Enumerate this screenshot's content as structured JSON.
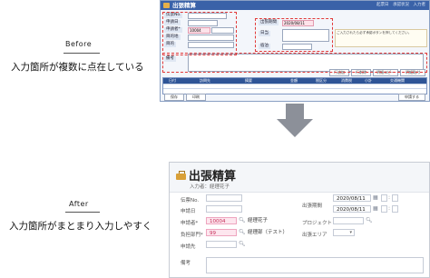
{
  "labels": {
    "before": "Before",
    "before_desc": "入力箇所が複数に点在している",
    "after": "After",
    "after_desc": "入力箇所がまとまり入力しやすく"
  },
  "before_screen": {
    "title": "出張精算",
    "header_right": "起票日　承認状況　入力者",
    "fields": [
      {
        "label": "伝票No.",
        "value": ""
      },
      {
        "label": "申請日",
        "value": ""
      },
      {
        "label": "申請者*",
        "value": "10004"
      },
      {
        "label": "目的地",
        "value": ""
      },
      {
        "label": "目的",
        "value": ""
      },
      {
        "label": "備考",
        "value": ""
      }
    ],
    "right_fields": [
      {
        "label": "出張期間",
        "value": "2020/08/11"
      },
      {
        "label": "日当",
        "value": ""
      },
      {
        "label": "宿泊",
        "value": ""
      }
    ],
    "note": "ご入力されたら必ず承認ボタンを押してください。",
    "toolbar": [
      "行追加",
      "行削除",
      "明細コピー",
      "明細貼付"
    ],
    "grid_headers": [
      "日付",
      "訪問先",
      "摘要",
      "金額",
      "税区分",
      "消費税",
      "小計",
      "交通機関"
    ],
    "grid_rows": [
      {
        "c1": "",
        "c2": "",
        "c3": ""
      },
      {
        "c1": "",
        "c2": "",
        "c3": ""
      }
    ],
    "bottom_left": [
      "保存",
      "印刷"
    ],
    "bottom_right": "申請する"
  },
  "after_screen": {
    "title": "出張精算",
    "subtitle": "入力者：経理花子",
    "fields": {
      "voucher_no": {
        "label": "伝票No."
      },
      "apply_date": {
        "label": "申請日"
      },
      "applicant": {
        "label": "申請者*",
        "code": "10004",
        "name": "経理花子"
      },
      "section": {
        "label": "負担部門*",
        "code": "99",
        "name": "経理部（テスト）"
      },
      "approver": {
        "label": "申請先"
      },
      "remarks": {
        "label": "備考"
      },
      "period": {
        "label": "出張期間",
        "from": "2020/08/11",
        "to": "2020/08/11"
      },
      "project": {
        "label": "プロジェクト"
      },
      "area": {
        "label": "出張エリア"
      }
    },
    "icons": {
      "search": "search-icon",
      "calendar": "calendar-icon",
      "dropdown": "chevron-down-icon"
    }
  },
  "colors": {
    "accent": "#3a62a8",
    "highlight_pink": "#fde6ee",
    "arrow": "#8c9099",
    "dotted": "#e23a3a"
  }
}
